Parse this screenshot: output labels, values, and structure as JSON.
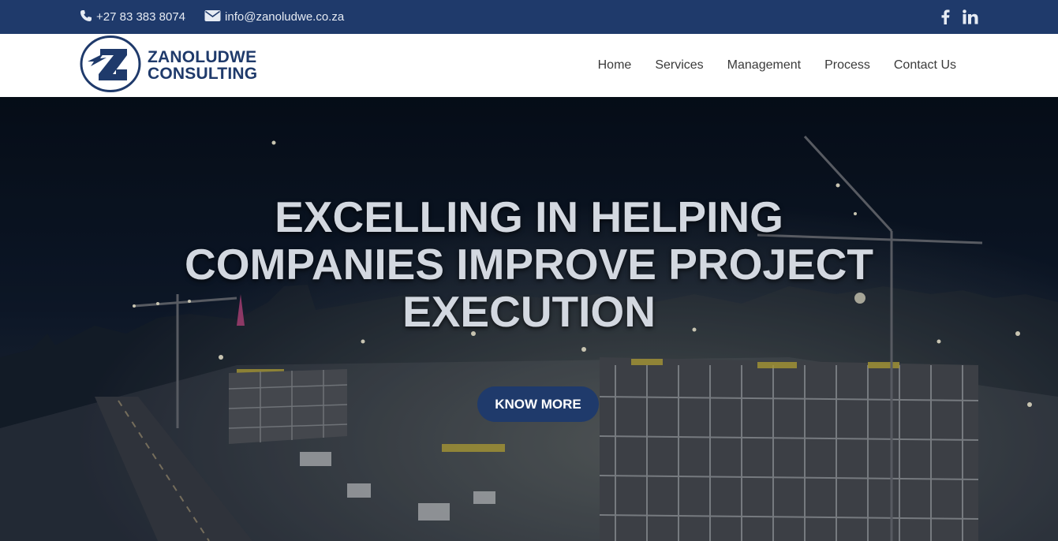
{
  "topbar": {
    "phone": "+27 83 383 8074",
    "email": "info@zanoludwe.co.za",
    "social": [
      "facebook-icon",
      "linkedin-icon"
    ]
  },
  "brand": {
    "line1": "ZANOLUDWE",
    "line2": "CONSULTING",
    "color": "#1f3a6b"
  },
  "nav": {
    "items": [
      "Home",
      "Services",
      "Management",
      "Process",
      "Contact Us"
    ]
  },
  "hero": {
    "headline": [
      "EXCELLING IN HELPING",
      "COMPANIES IMPROVE PROJECT",
      "EXECUTION"
    ],
    "cta": "KNOW MORE"
  },
  "colors": {
    "accent": "#1f3a6b",
    "headline": "#d3d8e0"
  }
}
